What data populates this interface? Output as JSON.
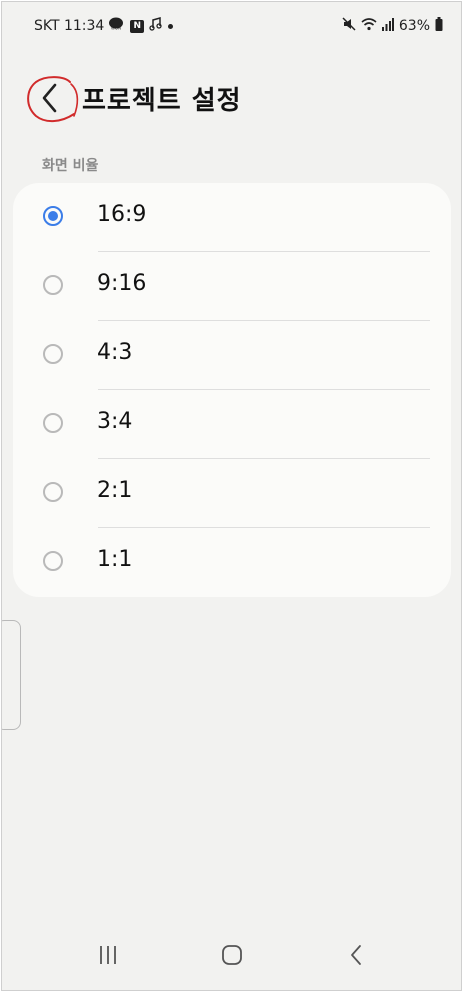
{
  "status_bar": {
    "carrier_time": "SKT 11:34",
    "badge_n": "N",
    "battery": "63%"
  },
  "header": {
    "title": "프로젝트 설정"
  },
  "section": {
    "label": "화면 비율"
  },
  "options": [
    {
      "label": "16:9",
      "selected": true
    },
    {
      "label": "9:16",
      "selected": false
    },
    {
      "label": "4:3",
      "selected": false
    },
    {
      "label": "3:4",
      "selected": false
    },
    {
      "label": "2:1",
      "selected": false
    },
    {
      "label": "1:1",
      "selected": false
    }
  ],
  "colors": {
    "accent": "#3b7de8",
    "annotation": "#d12b2b"
  },
  "icons": [
    "back-arrow-icon",
    "recent-apps-icon",
    "home-icon",
    "nav-back-icon",
    "wifi-icon",
    "signal-icon",
    "battery-icon",
    "mute-icon"
  ]
}
